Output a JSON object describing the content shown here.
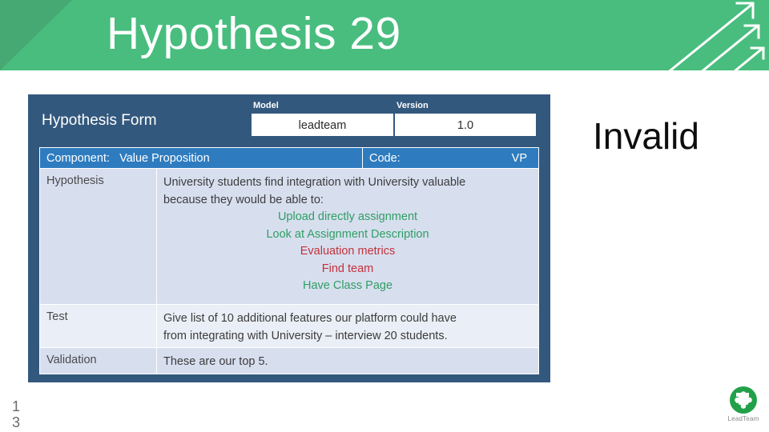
{
  "slide": {
    "title": "Hypothesis 29",
    "verdict": "Invalid",
    "page_number_line1": "1",
    "page_number_line2": "3"
  },
  "theme": {
    "header_green": "#48bd7e",
    "header_triangle_green": "#46a873",
    "panel_blue": "#33587d",
    "bar_blue": "#2e7cbf",
    "row_shade_dark": "#d7dfef",
    "row_shade_light": "#eaeef6",
    "positive_green": "#2f9e63",
    "negative_red": "#c5303a"
  },
  "form": {
    "title": "Hypothesis Form",
    "model": {
      "label": "Model",
      "value": "leadteam"
    },
    "version": {
      "label": "Version",
      "value": "1.0"
    },
    "component": {
      "label": "Component:",
      "value": "Value Proposition"
    },
    "code": {
      "label": "Code:",
      "value": "VP"
    },
    "rows": [
      {
        "label": "Hypothesis",
        "intro_line_1": "University students find integration with University valuable",
        "intro_line_2": "because they would be able to:",
        "bullets": [
          {
            "text": "Upload directly assignment",
            "status": "positive"
          },
          {
            "text": "Look at Assignment Description",
            "status": "positive"
          },
          {
            "text": "Evaluation metrics",
            "status": "negative"
          },
          {
            "text": "Find team",
            "status": "negative"
          },
          {
            "text": "Have Class Page",
            "status": "positive"
          }
        ]
      },
      {
        "label": "Test",
        "line_1": "Give list of 10 additional features our platform could have",
        "line_2": "from integrating with University – interview 20 students."
      },
      {
        "label": "Validation",
        "line_1": "These are our top 5."
      }
    ]
  },
  "branding": {
    "name": "LeadTeam",
    "mark_color": "#22a04a"
  },
  "icons": {
    "header_arrows": "diagonal-arrows-icon",
    "corner_triangle": "corner-triangle-icon",
    "logo_mark": "puzzle-piece-icon"
  }
}
